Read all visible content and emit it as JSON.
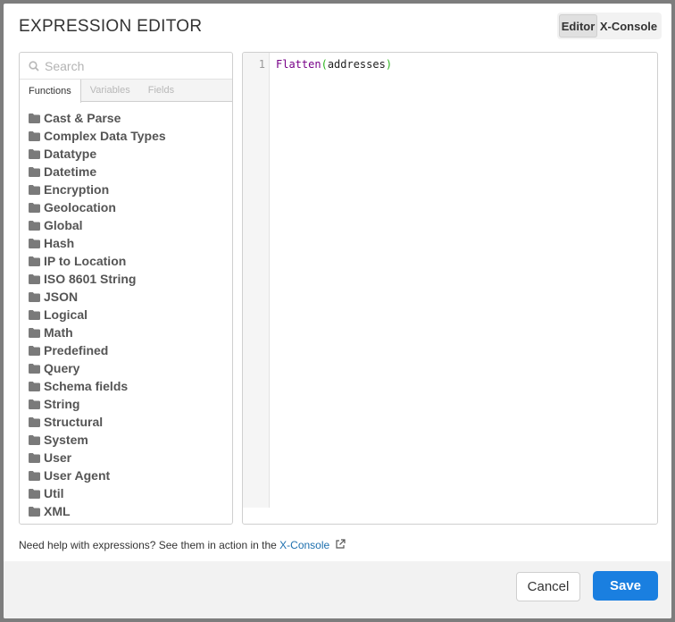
{
  "dialog": {
    "title": "EXPRESSION EDITOR",
    "mode_tabs": [
      "Editor",
      "X-Console"
    ],
    "active_mode": "Editor"
  },
  "sidebar": {
    "search_placeholder": "Search",
    "tabs": [
      {
        "label": "Functions",
        "active": true
      },
      {
        "label": "Variables",
        "active": false
      },
      {
        "label": "Fields",
        "active": false
      }
    ],
    "categories": [
      "Cast & Parse",
      "Complex Data Types",
      "Datatype",
      "Datetime",
      "Encryption",
      "Geolocation",
      "Global",
      "Hash",
      "IP to Location",
      "ISO 8601 String",
      "JSON",
      "Logical",
      "Math",
      "Predefined",
      "Query",
      "Schema fields",
      "String",
      "Structural",
      "System",
      "User",
      "User Agent",
      "Util",
      "XML"
    ],
    "category_icon": "folder-icon"
  },
  "editor": {
    "line_number": "1",
    "code": {
      "function": "Flatten",
      "open_paren": "(",
      "argument": "addresses",
      "close_paren": ")"
    }
  },
  "help": {
    "text": "Need help with expressions? See them in action in the ",
    "link": "X-Console",
    "icon": "external-link-icon"
  },
  "footer": {
    "cancel_label": "Cancel",
    "save_label": "Save"
  },
  "colors": {
    "accent": "#1a7fe0",
    "link": "#1d6fae",
    "code_function": "#770088",
    "code_paren": "#2db41e"
  }
}
